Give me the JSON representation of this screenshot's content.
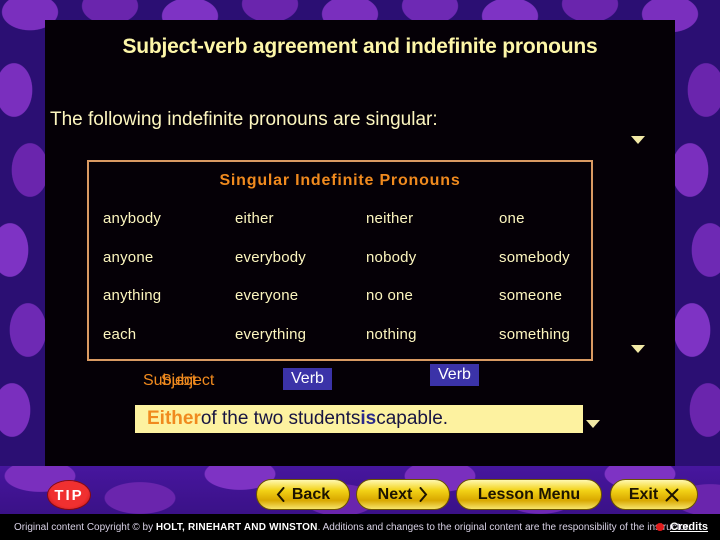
{
  "slide": {
    "title": "Subject-verb agreement and indefinite pronouns",
    "subtitle": "The following indefinite pronouns are singular:"
  },
  "table": {
    "title": "Singular Indefinite Pronouns",
    "rows": [
      [
        "anybody",
        "either",
        "neither",
        "one"
      ],
      [
        "anyone",
        "everybody",
        "nobody",
        "somebody"
      ],
      [
        "anything",
        "everyone",
        "no one",
        "someone"
      ],
      [
        "each",
        "everything",
        "nothing",
        "something"
      ]
    ]
  },
  "example": {
    "labels": {
      "subject_a": "Subject",
      "subject_b": "Subject",
      "verb_a": "Verb",
      "verb_b": "Verb"
    },
    "sentence": {
      "subject": "Either",
      "middle": " of the two students ",
      "verb": "is",
      "tail": " capable."
    }
  },
  "nav": {
    "tip": "TIP",
    "back": "Back",
    "next": "Next",
    "lesson_menu": "Lesson Menu",
    "exit": "Exit"
  },
  "footer": {
    "prefix": "Original content Copyright © by ",
    "publisher": "HOLT, RINEHART AND WINSTON",
    "suffix": ". Additions and changes to the original content are the responsibility of the instructor.",
    "credits": "Credits"
  },
  "colors": {
    "title": "#fdf6a8",
    "accent_orange": "#f08a1e",
    "table_border": "#d99a62",
    "highlight_bg": "#fdf2a0",
    "badge_blue": "#3b33a8",
    "button_gold": "#f2d216",
    "tip_red": "#e01b1b"
  }
}
